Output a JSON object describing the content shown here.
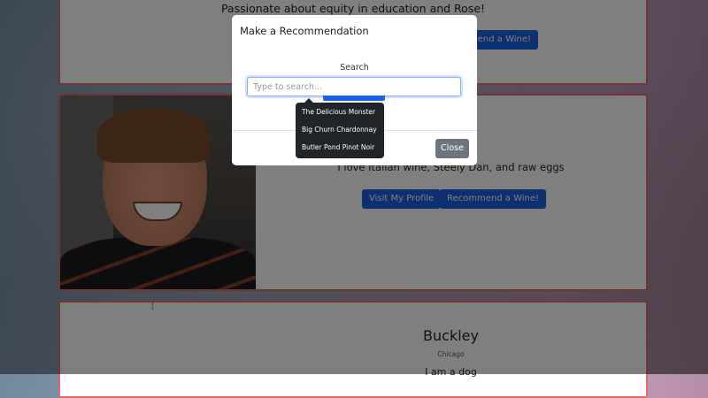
{
  "cards": [
    {
      "bio": "Passionate about equity in education and Rose!",
      "recommend_label": "Recommend a Wine!"
    },
    {
      "bio": "I love Italian wine, Steely Dan, and raw eggs",
      "visit_label": "Visit My Profile",
      "recommend_label": "Recommend a Wine!"
    },
    {
      "broken_image_alt": "[",
      "name": "Buckley",
      "city": "Chicago",
      "bio": "I am a dog"
    }
  ],
  "modal": {
    "title": "Make a Recommendation",
    "search_label": "Search",
    "search_placeholder": "Type to search...",
    "close_label": "Close"
  },
  "dropdown": {
    "items": [
      "The Delicious Monster",
      "Big Churn Chardonnay",
      "Butler Pond Pinot Noir"
    ]
  },
  "colors": {
    "primary": "#1a63e0",
    "secondary": "#6c757d",
    "card_border": "#e06a6a",
    "dropdown_bg": "#212529"
  }
}
